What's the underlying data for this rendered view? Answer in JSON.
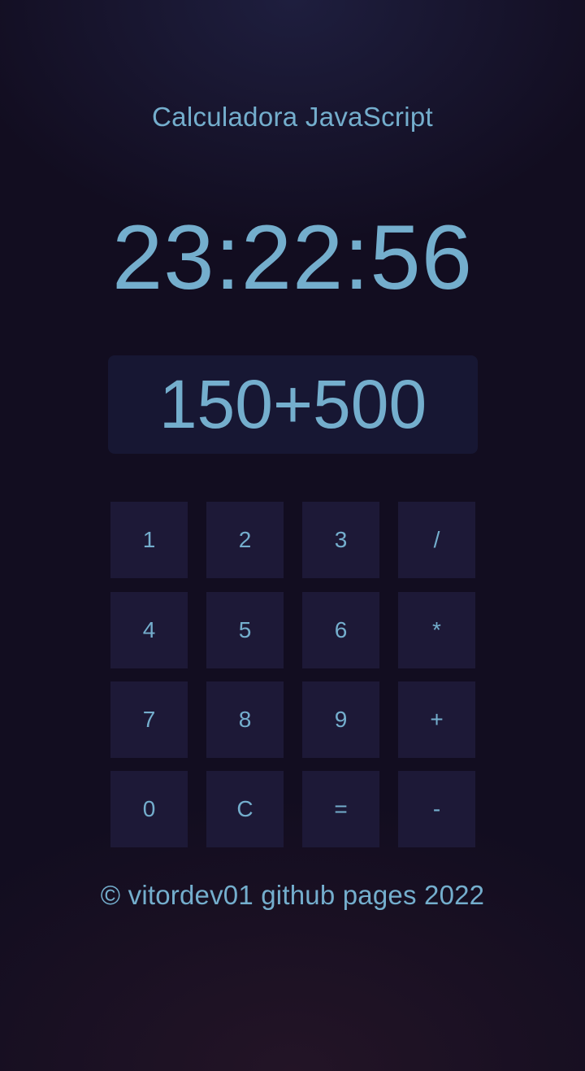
{
  "app": {
    "title": "Calculadora JavaScript"
  },
  "clock": {
    "time": "23:22:56"
  },
  "display": {
    "expression": "150+500"
  },
  "keypad": {
    "rows": [
      [
        "1",
        "2",
        "3",
        "/"
      ],
      [
        "4",
        "5",
        "6",
        "*"
      ],
      [
        "7",
        "8",
        "9",
        "+"
      ],
      [
        "0",
        "C",
        "=",
        "-"
      ]
    ]
  },
  "footer": {
    "text": "© vitordev01 github pages 2022"
  },
  "colors": {
    "text_accent": "#74aecd",
    "background": "#120d20",
    "key_background": "#1d1937",
    "display_background": "#171733"
  }
}
